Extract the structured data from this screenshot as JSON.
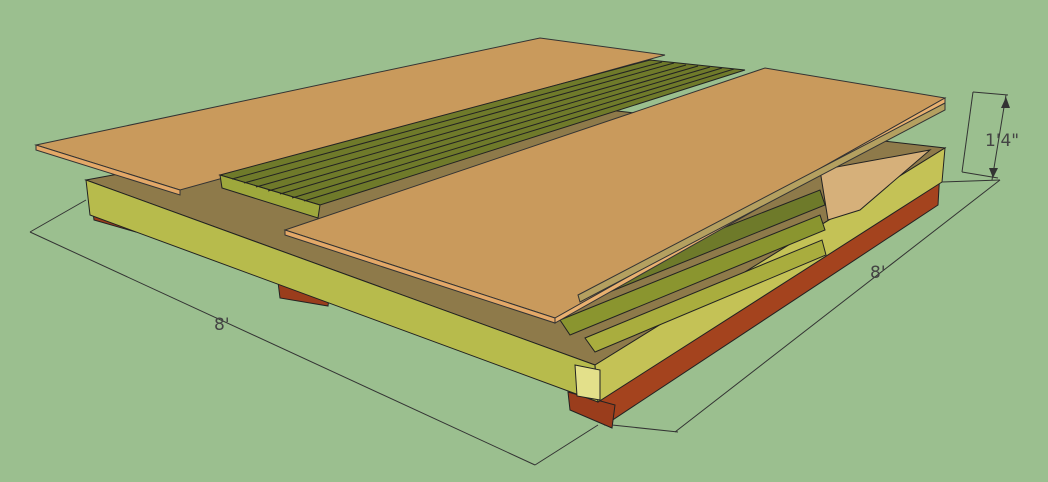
{
  "scene": {
    "dimensions": {
      "length_left": "8'",
      "length_right": "8'",
      "height": "1'4\""
    },
    "colors": {
      "background": "#9bbf8f",
      "plywood": "#c99a5c",
      "joist": "#b5b84a",
      "slat": "#7f8a2e",
      "skid": "#a4431e"
    }
  }
}
